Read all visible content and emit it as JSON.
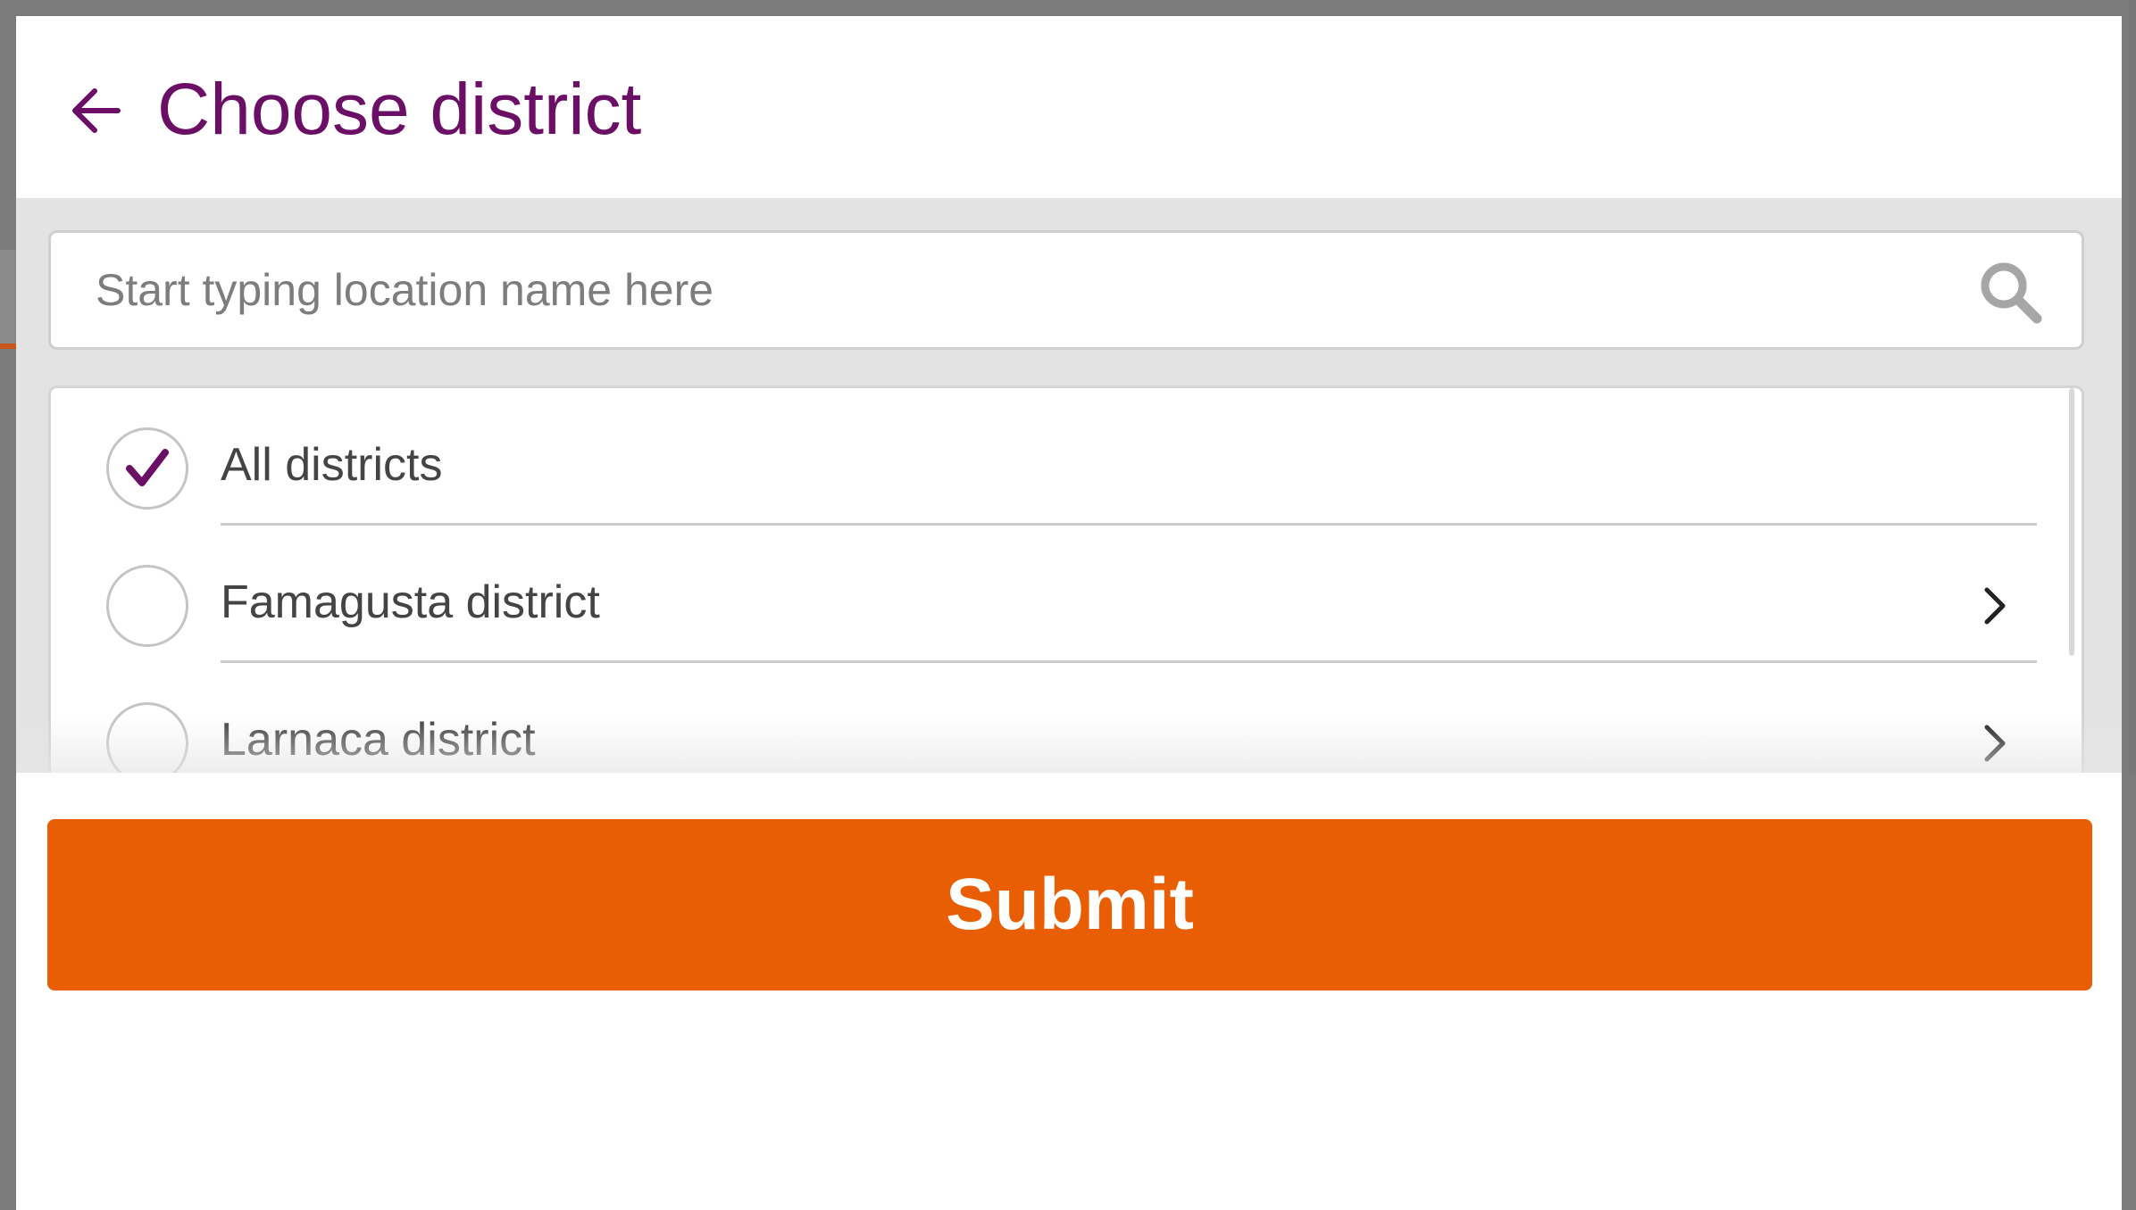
{
  "dialog": {
    "title": "Choose district",
    "back_icon": "arrow-left-icon"
  },
  "search": {
    "value": "",
    "placeholder": "Start typing location name here",
    "icon": "search-icon"
  },
  "districts": {
    "items": [
      {
        "label": "All districts",
        "selected": true,
        "has_children": false
      },
      {
        "label": "Famagusta district",
        "selected": false,
        "has_children": true
      },
      {
        "label": "Larnaca district",
        "selected": false,
        "has_children": true
      }
    ]
  },
  "footer": {
    "submit_label": "Submit"
  },
  "colors": {
    "title": "#6b0e66",
    "check": "#6b0e66",
    "submit_bg": "#e95e03",
    "panel_bg": "#e3e3e3",
    "overlay": "#7b7b7b"
  }
}
